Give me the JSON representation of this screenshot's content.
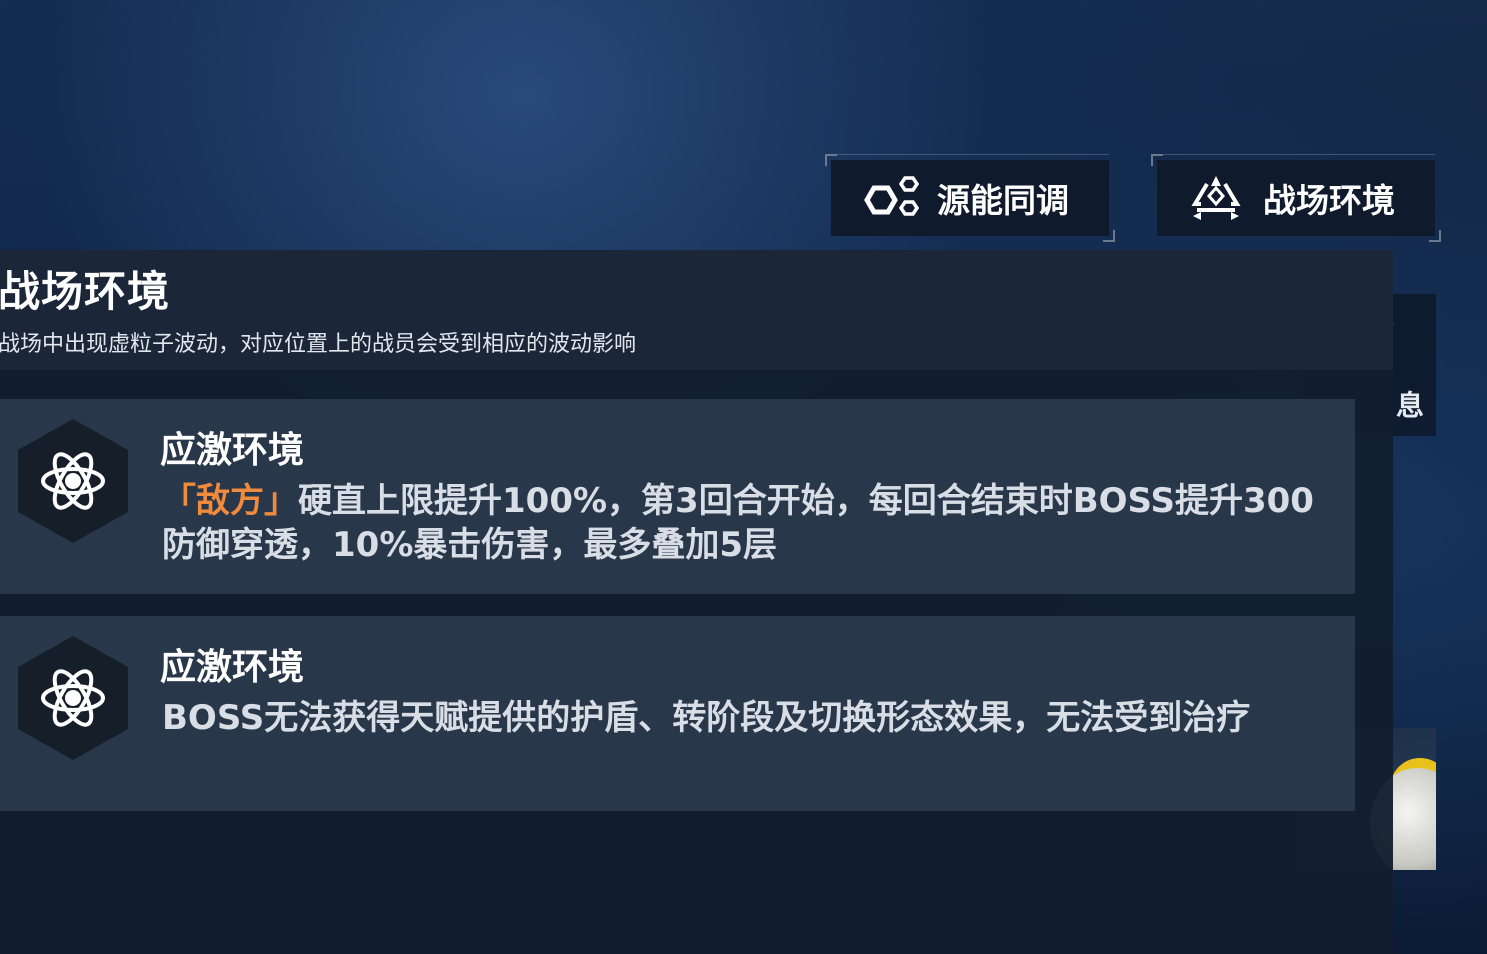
{
  "tabs": {
    "source_sync_label": "源能同调",
    "battlefield_label": "战场环境"
  },
  "side_panel": {
    "enemy_info_label": "息"
  },
  "panel": {
    "title": "战场环境",
    "subtitle": "战场中出现虚粒子波动，对应位置上的战员会受到相应的波动影响"
  },
  "effects": [
    {
      "icon": "atom-icon",
      "title": "应激环境",
      "highlight": "「敌方」",
      "text": "硬直上限提升100%，第3回合开始，每回合结束时BOSS提升300防御穿透，10%暴击伤害，最多叠加5层"
    },
    {
      "icon": "atom-icon",
      "title": "应激环境",
      "highlight": "",
      "text": "BOSS无法获得天赋提供的护盾、转阶段及切换形态效果，无法受到治疗"
    }
  ],
  "colors": {
    "highlight": "#f08a3c",
    "card_bg": "#29374a",
    "panel_bg": "#131e2f"
  }
}
